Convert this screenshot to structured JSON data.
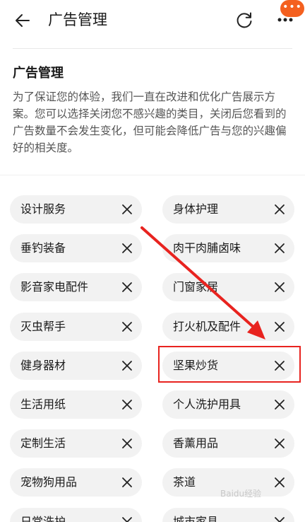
{
  "header": {
    "title": "广告管理",
    "badge": "•••"
  },
  "section": {
    "title": "广告管理",
    "description": "为了保证您的体验，我们一直在改进和优化广告展示方案。您可以选择关闭您不感兴趣的类目，关闭后您看到的广告数量不会发生变化，但可能会降低广告与您的兴趣偏好的相关度。"
  },
  "tags": [
    {
      "label": "设计服务"
    },
    {
      "label": "身体护理"
    },
    {
      "label": "垂钓装备"
    },
    {
      "label": "肉干肉脯卤味"
    },
    {
      "label": "影音家电配件"
    },
    {
      "label": "门窗家居"
    },
    {
      "label": "灭虫帮手"
    },
    {
      "label": "打火机及配件"
    },
    {
      "label": "健身器材"
    },
    {
      "label": "坚果炒货"
    },
    {
      "label": "生活用纸"
    },
    {
      "label": "个人洗护用具"
    },
    {
      "label": "定制生活"
    },
    {
      "label": "香薰用品"
    },
    {
      "label": "宠物狗用品"
    },
    {
      "label": "茶道"
    },
    {
      "label": "日常洗护"
    },
    {
      "label": "城市家具"
    }
  ],
  "watermark": "Baidu经验",
  "colors": {
    "accent": "#f4601f",
    "annotation": "#e8231f",
    "tag_bg": "#f2f2f2"
  },
  "icons": [
    "back-arrow-icon",
    "refresh-icon",
    "more-icon",
    "close-icon"
  ]
}
